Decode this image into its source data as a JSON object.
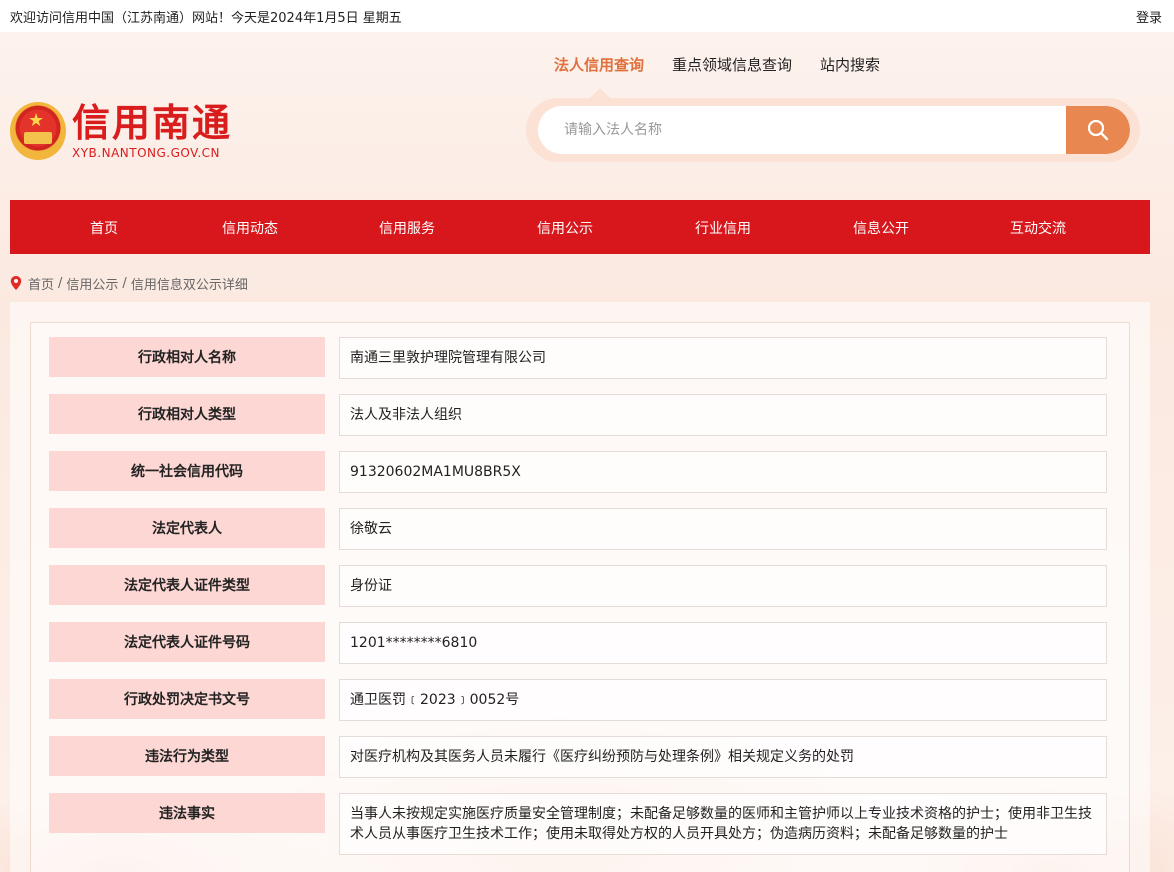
{
  "topbar": {
    "welcome": "欢迎访问信用中国（江苏南通）网站！今天是2024年1月5日 星期五",
    "login": "登录"
  },
  "logo": {
    "title": "信用南通",
    "subtitle": "XYB.NANTONG.GOV.CN"
  },
  "search": {
    "tabs": [
      {
        "label": "法人信用查询",
        "active": true
      },
      {
        "label": "重点领域信息查询",
        "active": false
      },
      {
        "label": "站内搜索",
        "active": false
      }
    ],
    "placeholder": "请输入法人名称",
    "value": ""
  },
  "nav": {
    "items": [
      {
        "label": "首页"
      },
      {
        "label": "信用动态"
      },
      {
        "label": "信用服务"
      },
      {
        "label": "信用公示"
      },
      {
        "label": "行业信用"
      },
      {
        "label": "信息公开"
      },
      {
        "label": "互动交流"
      }
    ]
  },
  "breadcrumb": {
    "items": [
      "首页",
      "信用公示",
      "信用信息双公示详细"
    ],
    "separator": "/"
  },
  "details": [
    {
      "label": "行政相对人名称",
      "value": "南通三里敦护理院管理有限公司"
    },
    {
      "label": "行政相对人类型",
      "value": "法人及非法人组织"
    },
    {
      "label": "统一社会信用代码",
      "value": "91320602MA1MU8BR5X"
    },
    {
      "label": "法定代表人",
      "value": "徐敬云"
    },
    {
      "label": "法定代表人证件类型",
      "value": "身份证"
    },
    {
      "label": "法定代表人证件号码",
      "value": "1201********6810"
    },
    {
      "label": "行政处罚决定书文号",
      "value": "通卫医罚﹝2023﹞0052号"
    },
    {
      "label": "违法行为类型",
      "value": "对医疗机构及其医务人员未履行《医疗纠纷预防与处理条例》相关规定义务的处罚"
    },
    {
      "label": "违法事实",
      "value": "当事人未按规定实施医疗质量安全管理制度；未配备足够数量的医师和主管护师以上专业技术资格的护士；使用非卫生技术人员从事医疗卫生技术工作；使用未取得处方权的人员开具处方；伪造病历资料；未配备足够数量的护士"
    }
  ],
  "colors": {
    "brand_red": "#d8171c",
    "accent_orange": "#e8874f",
    "label_bg": "#fcd7d3"
  }
}
